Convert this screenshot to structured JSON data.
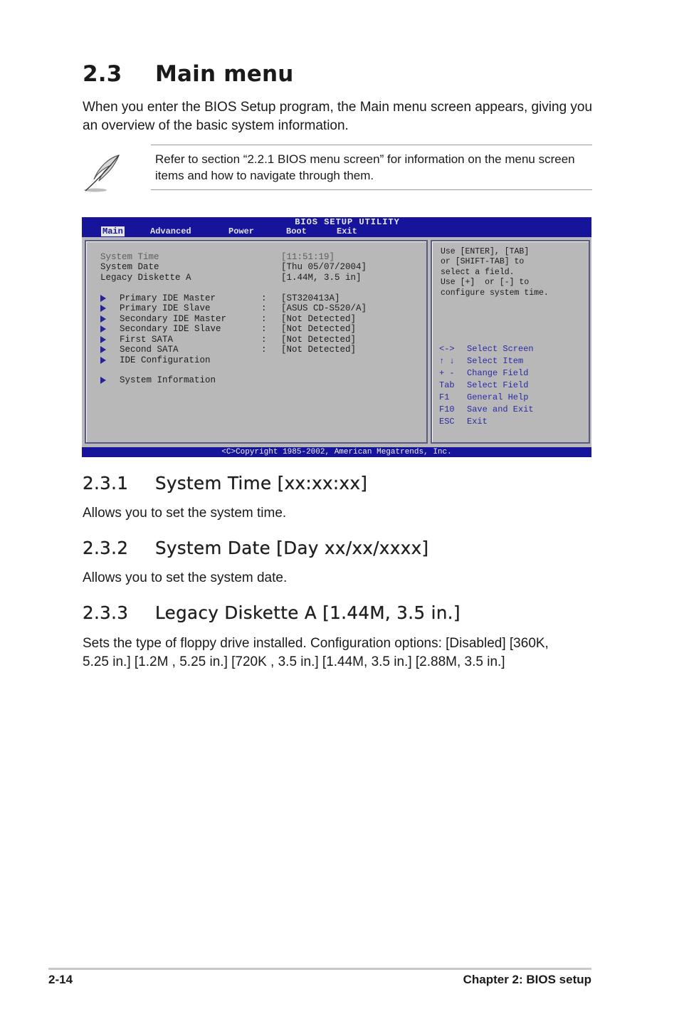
{
  "section": {
    "number": "2.3",
    "title": "Main menu",
    "intro": "When you enter the BIOS Setup program, the Main menu screen appears, giving you an overview of the basic system information."
  },
  "note": {
    "icon": "feather-pen-icon",
    "text": "Refer to section “2.2.1  BIOS menu screen” for information on the menu screen items and how to navigate through them."
  },
  "bios": {
    "title": "BIOS SETUP UTILITY",
    "tabs": [
      "Main",
      "Advanced",
      "Power",
      "Boot",
      "Exit"
    ],
    "active_tab": "Main",
    "fields": [
      {
        "label": "System Time",
        "value": "[11:51:19]"
      },
      {
        "label": "System Date",
        "value": "[Thu 05/07/2004]"
      },
      {
        "label": "Legacy Diskette A",
        "value": "[1.44M, 3.5 in]"
      }
    ],
    "submenus": [
      {
        "label": "Primary IDE Master",
        "sep": ":",
        "value": "[ST320413A]"
      },
      {
        "label": "Primary IDE Slave",
        "sep": ":",
        "value": "[ASUS CD-S520/A]"
      },
      {
        "label": "Secondary IDE Master",
        "sep": ":",
        "value": "[Not Detected]"
      },
      {
        "label": "Secondary IDE Slave",
        "sep": ":",
        "value": "[Not Detected]"
      },
      {
        "label": "First SATA",
        "sep": ":",
        "value": "[Not Detected]"
      },
      {
        "label": "Second SATA",
        "sep": ":",
        "value": "[Not Detected]"
      },
      {
        "label": "IDE Configuration",
        "sep": "",
        "value": ""
      },
      {
        "label": "System Information",
        "sep": "",
        "value": ""
      }
    ],
    "help_lines": [
      "Use [ENTER], [TAB]",
      "or [SHIFT-TAB] to",
      "select a field.",
      "Use [+]  or [-] to",
      "configure system time."
    ],
    "keys": [
      {
        "key": "<->",
        "action": "Select Screen"
      },
      {
        "key": "↑ ↓",
        "action": "Select Item"
      },
      {
        "key": "+ -",
        "action": "Change Field"
      },
      {
        "key": "Tab",
        "action": "Select Field"
      },
      {
        "key": "F1",
        "action": "General Help"
      },
      {
        "key": "F10",
        "action": "Save and Exit"
      },
      {
        "key": "ESC",
        "action": "Exit"
      }
    ],
    "copyright": "<C>Copyright 1985-2002, American Megatrends, Inc.",
    "colors": {
      "bar": "#16149a",
      "panel": "#b8b8b8",
      "help_keys": "#2a2aa6"
    }
  },
  "subsections": [
    {
      "number": "2.3.1",
      "title": "System Time [xx:xx:xx]",
      "body": "Allows you to set the system time."
    },
    {
      "number": "2.3.2",
      "title": "System Date [Day xx/xx/xxxx]",
      "body": "Allows you to set the system date."
    },
    {
      "number": "2.3.3",
      "title": "Legacy Diskette A [1.44M, 3.5 in.]",
      "body": "Sets the type of floppy drive installed. Configuration options: [Disabled] [360K, 5.25 in.] [1.2M , 5.25 in.] [720K , 3.5 in.] [1.44M, 3.5 in.] [2.88M, 3.5 in.]"
    }
  ],
  "footer": {
    "page": "2-14",
    "chapter": "Chapter 2: BIOS setup"
  }
}
